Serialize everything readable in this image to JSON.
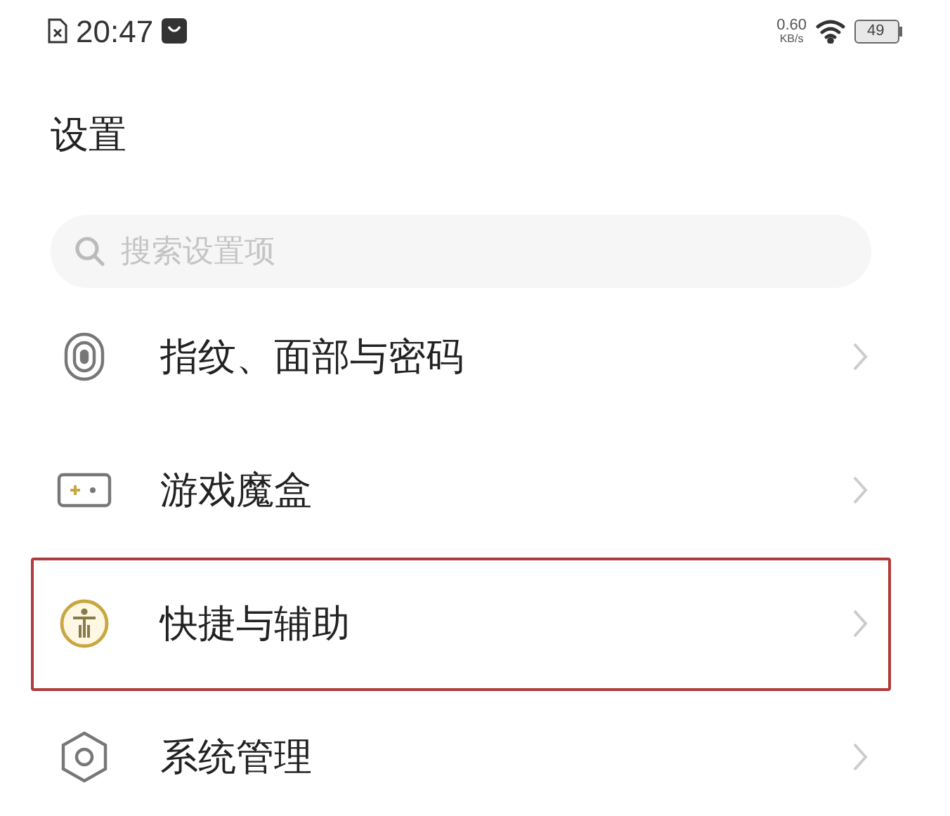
{
  "status_bar": {
    "time": "20:47",
    "speed": "0.60",
    "speed_unit": "KB/s",
    "battery": "49"
  },
  "title": "设置",
  "search": {
    "placeholder": "搜索设置项"
  },
  "items": [
    {
      "label": "指纹、面部与密码",
      "highlighted": false
    },
    {
      "label": "游戏魔盒",
      "highlighted": false
    },
    {
      "label": "快捷与辅助",
      "highlighted": true
    },
    {
      "label": "系统管理",
      "highlighted": false
    }
  ]
}
